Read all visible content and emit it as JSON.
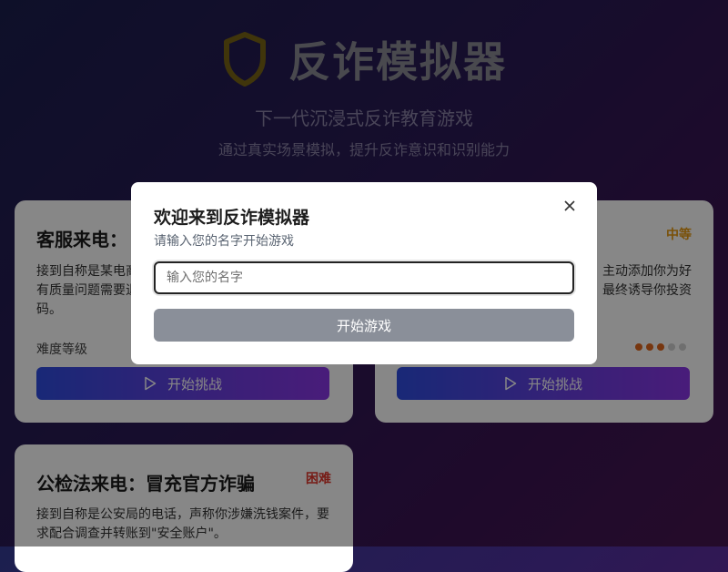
{
  "app": {
    "title": "反诈模拟器",
    "subtitle": "下一代沉浸式反诈教育游戏",
    "tagline": "通过真实场景模拟，提升反诈意识和识别能力"
  },
  "cards": [
    {
      "title": "客服来电：",
      "badge": "",
      "desc_lines": [
        "接到自称是某电商",
        "有质量问题需要退",
        "码。"
      ],
      "difficulty_label": "难度等级",
      "button": "开始挑战"
    },
    {
      "title": "",
      "badge": "中等",
      "badge_color": "#e69a12",
      "desc_lines": [
        "主动添加你为好",
        "最终诱导你投资"
      ],
      "difficulty_label": "",
      "difficulty_level": 3,
      "difficulty_max": 5,
      "button": "开始挑战"
    },
    {
      "title": "公检法来电：冒充官方诈骗",
      "badge": "困难",
      "badge_color": "#e0352b",
      "desc_lines": [
        "接到自称是公安局的电话，声称你涉嫌洗钱案件，要",
        "求配合调查并转账到\"安全账户\"。"
      ]
    }
  ],
  "modal": {
    "title": "欢迎来到反诈模拟器",
    "subtitle": "请输入您的名字开始游戏",
    "input_placeholder": "输入您的名字",
    "input_value": "",
    "start_button": "开始游戏",
    "close_icon": "close-icon"
  },
  "colors": {
    "accent": "#5a45e0",
    "shield": "#e6b31e",
    "medium": "#e69a12",
    "hard": "#e0352b",
    "disabled_button": "#8a8f99"
  }
}
